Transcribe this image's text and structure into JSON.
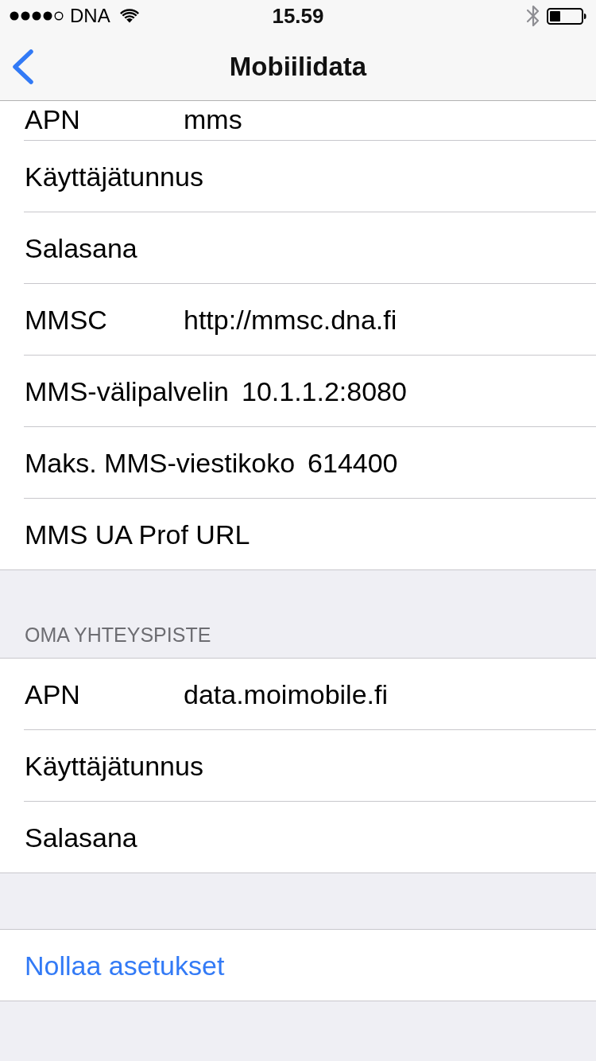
{
  "status_bar": {
    "carrier": "DNA",
    "time": "15.59"
  },
  "nav_bar": {
    "title": "Mobiilidata"
  },
  "sections": [
    {
      "rows": [
        {
          "kind": "field",
          "label": "APN",
          "value": "mms"
        },
        {
          "kind": "field",
          "label": "Käyttäjätunnus"
        },
        {
          "kind": "field",
          "label": "Salasana"
        },
        {
          "kind": "field",
          "label": "MMSC",
          "value": "http://mmsc.dna.fi"
        },
        {
          "kind": "field",
          "label": "MMS-välipalvelin",
          "value": "10.1.1.2:8080"
        },
        {
          "kind": "field",
          "label": "Maks. MMS-viestikoko",
          "value": "614400"
        },
        {
          "kind": "field",
          "label": "MMS UA Prof URL"
        }
      ]
    },
    {
      "title": "OMA YHTEYSPISTE",
      "rows": [
        {
          "kind": "field",
          "label": "APN",
          "value": "data.moimobile.fi"
        },
        {
          "kind": "field",
          "label": "Käyttäjätunnus"
        },
        {
          "kind": "field",
          "label": "Salasana"
        }
      ]
    },
    {
      "rows": [
        {
          "kind": "action",
          "label": "Nollaa asetukset"
        }
      ]
    }
  ]
}
